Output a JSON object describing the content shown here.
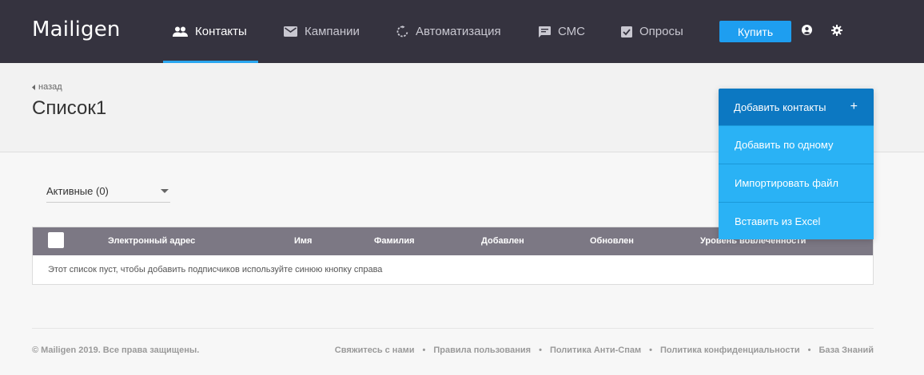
{
  "header": {
    "logo": "Mailigen",
    "nav": [
      {
        "label": "Контакты",
        "icon": "contacts-icon",
        "active": true
      },
      {
        "label": "Кампании",
        "icon": "mail-icon"
      },
      {
        "label": "Автоматизация",
        "icon": "automation-icon"
      },
      {
        "label": "СМС",
        "icon": "sms-icon"
      },
      {
        "label": "Опросы",
        "icon": "survey-icon"
      }
    ],
    "buy_label": "Купить",
    "icons": [
      "user-icon",
      "gear-icon"
    ]
  },
  "page": {
    "back_label": "назад",
    "title": "Список1"
  },
  "filter": {
    "selected": "Активные (0)"
  },
  "table": {
    "columns": [
      "Электронный адрес",
      "Имя",
      "Фамилия",
      "Добавлен",
      "Обновлен",
      "Уровень вовлеченности"
    ],
    "empty_message": "Этот список пуст, чтобы добавить подписчиков используйте синюю кнопку справа"
  },
  "dropdown": {
    "title": "Добавить контакты",
    "items": [
      "Добавить по одному",
      "Импортировать файл",
      "Вставить из Excel"
    ]
  },
  "footer": {
    "copyright": "© Mailigen 2019. Все права защищены.",
    "links": [
      "Свяжитесь с нами",
      "Правила пользования",
      "Политика Анти-Спам",
      "Политика конфиденциальности",
      "База Знаний"
    ],
    "separator": "•"
  },
  "colors": {
    "header_bg": "#35333f",
    "accent": "#2aa7f0",
    "dropdown_head": "#0c78c2",
    "dropdown_item": "#2ab2f5",
    "table_head": "#7c7884"
  }
}
